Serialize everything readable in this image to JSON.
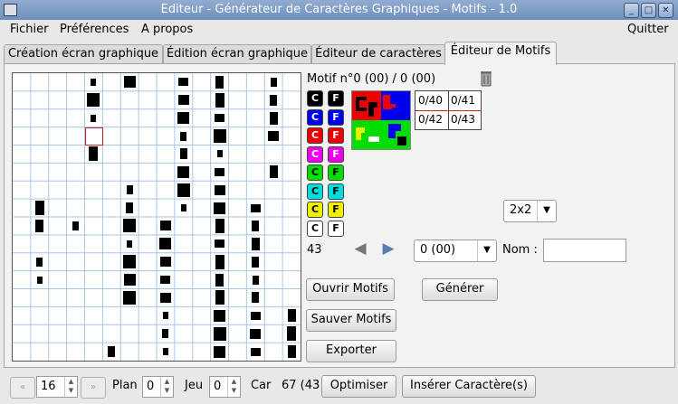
{
  "window": {
    "title": "Editeur - Générateur de Caractères Graphiques - Motifs - 1.0",
    "controls": [
      "_",
      "□",
      "✕"
    ]
  },
  "menu": {
    "items": [
      "Fichier",
      "Préférences",
      "A propos"
    ],
    "quit": "Quitter"
  },
  "tabs": [
    {
      "label": "Création écran graphique",
      "active": false
    },
    {
      "label": "Édition écran graphique",
      "active": false
    },
    {
      "label": "Éditeur de caractères",
      "active": false
    },
    {
      "label": "Éditeur de Motifs",
      "active": true
    }
  ],
  "motif": {
    "header": "Motif n°0 (00) / 0 (00)",
    "count": "43",
    "codes": [
      "0/40",
      "0/41",
      "0/42",
      "0/43"
    ],
    "size_value": "2x2",
    "motif_select": "0 (00)",
    "name_label": "Nom :",
    "name_value": ""
  },
  "color_buttons": [
    {
      "c": "C",
      "f": "F",
      "color": "#000000",
      "text": "#ffffff"
    },
    {
      "c": "C",
      "f": "F",
      "color": "#0000ee",
      "text": "#ffffff"
    },
    {
      "c": "C",
      "f": "F",
      "color": "#ee0000",
      "text": "#ffffff"
    },
    {
      "c": "C",
      "f": "F",
      "color": "#ee00ee",
      "text": "#ffffff"
    },
    {
      "c": "C",
      "f": "F",
      "color": "#00dd00",
      "text": "#000000"
    },
    {
      "c": "C",
      "f": "F",
      "color": "#00dddd",
      "text": "#000000"
    },
    {
      "c": "C",
      "f": "F",
      "color": "#eeee00",
      "text": "#000000"
    },
    {
      "c": "C",
      "f": "F",
      "color": "#ffffff",
      "text": "#000000"
    }
  ],
  "buttons": {
    "open": "Ouvrir Motifs",
    "save": "Sauver Motifs",
    "export": "Exporter",
    "generate": "Générer",
    "optimize": "Optimiser",
    "insert": "Insérer Caractère(s)"
  },
  "bottom": {
    "page_value": "16",
    "plan_label": "Plan",
    "plan_value": "0",
    "jeu_label": "Jeu",
    "jeu_value": "0",
    "car_label": "Car",
    "car_value": "67 (43"
  },
  "icons": {
    "trash": "trash-icon",
    "prev": "arrow-left-icon",
    "next": "arrow-right-icon",
    "first": "double-chevron-left-icon",
    "last": "double-chevron-right-icon"
  }
}
